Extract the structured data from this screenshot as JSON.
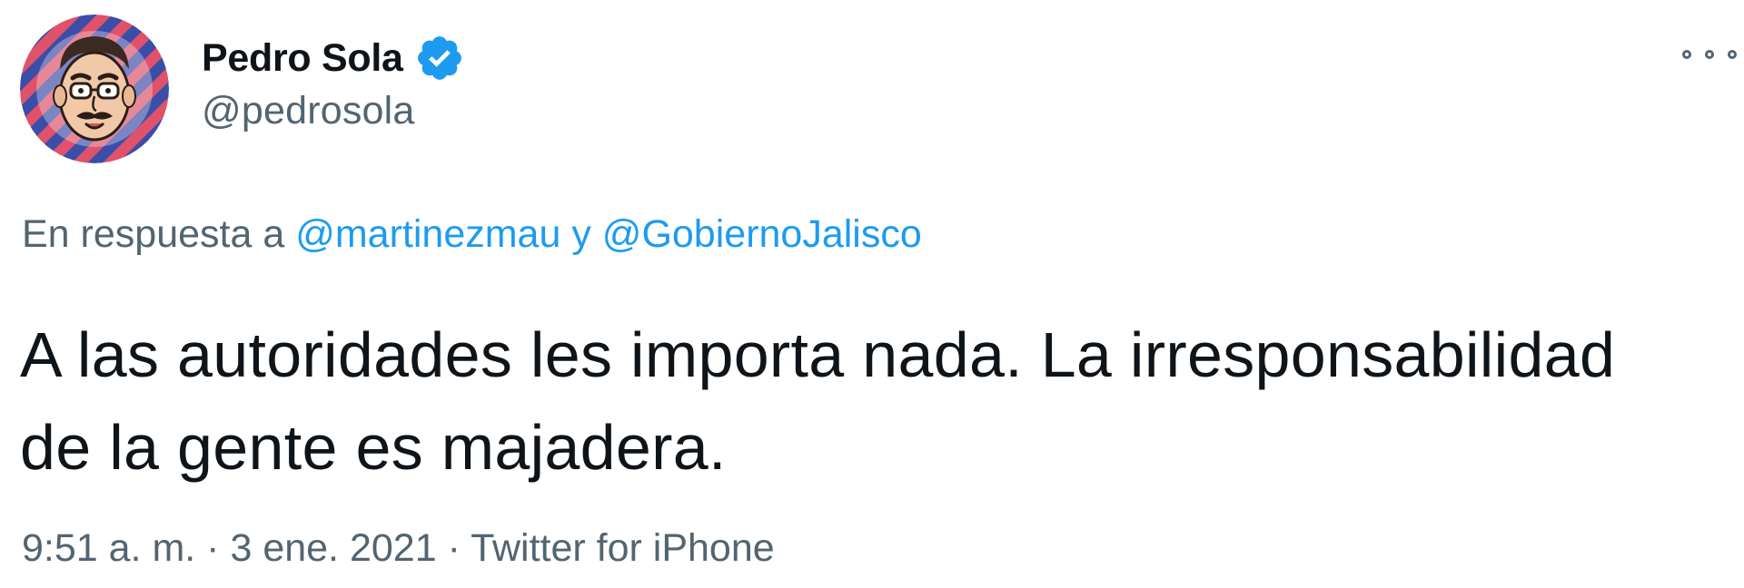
{
  "author": {
    "display_name": "Pedro Sola",
    "handle": "@pedrosola",
    "verified": true,
    "avatar_icon": "cartoon-face-avatar"
  },
  "menu": {
    "icon": "more-options-icon"
  },
  "reply": {
    "prefix": "En respuesta a",
    "mention_1": "@martinezmau",
    "conjunction": "y",
    "mention_2": "@GobiernoJalisco"
  },
  "tweet": {
    "line_1": "A las autoridades les importa nada. La irresponsabilidad",
    "line_2": "de la gente es majadera."
  },
  "meta": {
    "time": "9:51 a. m.",
    "separator_1": "·",
    "date": "3 ene. 2021",
    "separator_2": "·",
    "source": "Twitter for iPhone"
  },
  "colors": {
    "link": "#1d9bf0",
    "secondary_text": "#536471",
    "primary_text": "#0f1419",
    "verified_badge": "#1d9bf0"
  }
}
